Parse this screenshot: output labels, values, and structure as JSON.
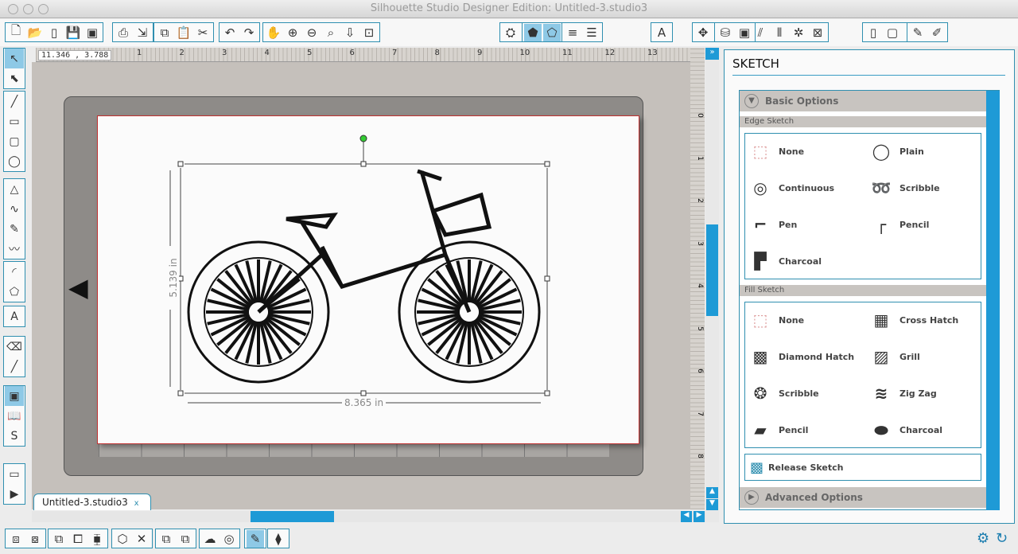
{
  "window": {
    "title": "Silhouette Studio Designer Edition: Untitled-3.studio3"
  },
  "toolbar": {
    "groups": [
      [
        [
          "new-document",
          "🗋"
        ],
        [
          "open-folder",
          "📂"
        ],
        [
          "new-page",
          "▯"
        ],
        [
          "save",
          "💾"
        ],
        [
          "save-to-sd",
          "▣"
        ]
      ],
      [
        [
          "print",
          "⎙"
        ],
        [
          "send-to-silhouette",
          "⇲"
        ]
      ],
      [
        [
          "copy",
          "⧉"
        ],
        [
          "paste",
          "📋"
        ],
        [
          "cut",
          "✂"
        ]
      ],
      [
        [
          "undo",
          "↶"
        ],
        [
          "redo",
          "↷"
        ]
      ],
      [
        [
          "pan-hand",
          "✋"
        ],
        [
          "zoom-in",
          "⊕"
        ],
        [
          "zoom-out",
          "⊖"
        ],
        [
          "zoom-select",
          "⌕"
        ],
        [
          "zoom-fit-drag",
          "⇩"
        ],
        [
          "fit-to-page",
          "⊡"
        ]
      ],
      [
        [
          "page-settings",
          "⛭"
        ],
        [
          "grid",
          "▦"
        ],
        [
          "registration",
          "▩"
        ]
      ],
      [
        [
          "fill-color",
          "⬟",
          1
        ],
        [
          "line-color",
          "⬠",
          1
        ],
        [
          "line-style",
          "✩"
        ],
        [
          "sketch",
          "⬠"
        ]
      ],
      [
        [
          "color-swatch",
          "≡"
        ],
        [
          "line-weight",
          "☰"
        ]
      ],
      [
        [
          "text-style",
          "A"
        ]
      ],
      [
        [
          "offset",
          "✥"
        ],
        [
          "rotate",
          "↻"
        ],
        [
          "scale",
          "⤡"
        ],
        [
          "shear",
          "⫽"
        ],
        [
          "align",
          "⫴"
        ],
        [
          "replicate",
          "✲"
        ],
        [
          "nest",
          "⊠"
        ]
      ],
      [
        [
          "library",
          "⛁"
        ],
        [
          "design-store",
          "▣"
        ]
      ],
      [
        [
          "cut-settings",
          "▯"
        ],
        [
          "modify",
          "▢"
        ],
        [
          "grid-settings",
          "▦"
        ]
      ],
      [
        [
          "knife",
          "✎"
        ],
        [
          "sketch-pen",
          "✐"
        ]
      ]
    ]
  },
  "left_tools": [
    [
      [
        "select",
        "↖",
        1
      ],
      [
        "point-edit",
        "⬉"
      ]
    ],
    [
      [
        "line",
        "╱"
      ],
      [
        "rectangle",
        "▭"
      ],
      [
        "rounded-rectangle",
        "▢"
      ],
      [
        "ellipse",
        "◯"
      ]
    ],
    [
      [
        "polyline",
        "△"
      ],
      [
        "curve",
        "∿"
      ],
      [
        "freehand",
        "✎"
      ],
      [
        "smooth-freehand",
        "〰"
      ]
    ],
    [
      [
        "arc",
        "◜"
      ],
      [
        "polygon",
        "⬠"
      ]
    ],
    [
      [
        "text",
        "A"
      ]
    ],
    [
      [
        "eraser",
        "⌫"
      ],
      [
        "knife",
        "╱"
      ]
    ],
    [
      [
        "design-view",
        "▣",
        1
      ],
      [
        "library-view",
        "📖"
      ],
      [
        "store",
        "S"
      ]
    ],
    [
      [
        "show-panel",
        "▭"
      ],
      [
        "send-panel",
        "▶"
      ]
    ]
  ],
  "ruler": {
    "coords": "11.346 , 3.788",
    "ticks": [
      "1",
      "2",
      "3",
      "4",
      "5",
      "6",
      "7",
      "8",
      "9",
      "10",
      "11",
      "12",
      "13"
    ],
    "vticks": [
      "0",
      "1",
      "2",
      "3",
      "4",
      "5",
      "6",
      "7",
      "8"
    ]
  },
  "canvas": {
    "width_label": "8.365 in",
    "height_label": "5.139 in"
  },
  "document_tab": {
    "label": "Untitled-3.studio3",
    "close": "x"
  },
  "panel": {
    "title": "SKETCH",
    "basic_options": "Basic Options",
    "edge_sketch": "Edge Sketch",
    "edge_options": [
      [
        "None",
        "none",
        "⬚"
      ],
      [
        "Plain",
        "plain",
        "◯"
      ],
      [
        "Continuous",
        "continuous",
        "◎"
      ],
      [
        "Scribble",
        "scribble",
        "➿"
      ],
      [
        "Pen",
        "pen",
        "⌐"
      ],
      [
        "Pencil",
        "pencil",
        "┌"
      ],
      [
        "Charcoal",
        "charcoal",
        "▛"
      ]
    ],
    "fill_sketch": "Fill Sketch",
    "fill_options": [
      [
        "None",
        "none",
        "⬚"
      ],
      [
        "Cross Hatch",
        "cross-hatch",
        "▦"
      ],
      [
        "Diamond Hatch",
        "diamond-hatch",
        "▩"
      ],
      [
        "Grill",
        "grill",
        "▨"
      ],
      [
        "Scribble",
        "scribble",
        "❂"
      ],
      [
        "Zig Zag",
        "zig-zag",
        "≋"
      ],
      [
        "Pencil",
        "pencil",
        "▰"
      ],
      [
        "Charcoal",
        "charcoal",
        "⬬"
      ]
    ],
    "release_sketch": "Release Sketch",
    "advanced_options": "Advanced Options"
  },
  "bottom_toolbar": {
    "groups": [
      [
        [
          "group",
          "⧈"
        ],
        [
          "ungroup",
          "⧇"
        ]
      ],
      [
        [
          "compound-path",
          "⧉"
        ],
        [
          "release-compound",
          "⧠"
        ],
        [
          "bring-forward",
          "⧯"
        ]
      ],
      [
        [
          "3d-box",
          "⬡"
        ],
        [
          "delete",
          "✕"
        ]
      ],
      [
        [
          "send-backward",
          "⧉"
        ],
        [
          "bring-front",
          "⧉"
        ]
      ],
      [
        [
          "weld",
          "☁"
        ],
        [
          "offset-rings",
          "◎"
        ]
      ],
      [
        [
          "trace",
          "✎",
          1
        ]
      ],
      [
        [
          "layers",
          "⧫"
        ]
      ]
    ]
  },
  "colors": {
    "accent": "#2f8fb0",
    "selected": "#8ec9e6",
    "scroll": "#1e9ad6",
    "mat": "#8e8b88",
    "canvas": "#c5c0bb"
  }
}
